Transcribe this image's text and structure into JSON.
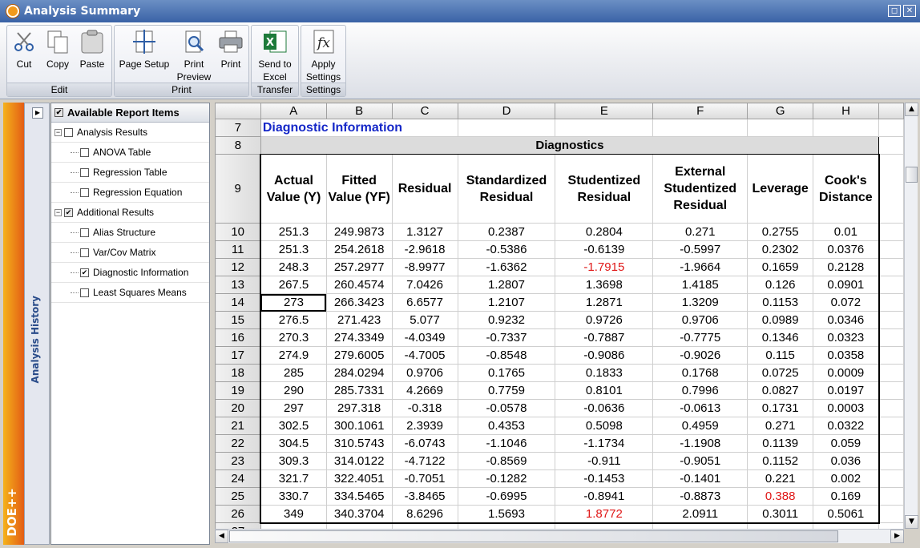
{
  "window": {
    "title": "Analysis Summary"
  },
  "ribbon": {
    "groups": [
      {
        "label": "Edit",
        "buttons": [
          "Cut",
          "Copy",
          "Paste"
        ]
      },
      {
        "label": "Print",
        "buttons": [
          "Page Setup",
          "Print Preview",
          "Print"
        ]
      },
      {
        "label": "Transfer",
        "buttons": [
          "Send to Excel"
        ]
      },
      {
        "label": "Settings",
        "buttons": [
          "Apply Settings"
        ]
      }
    ]
  },
  "brand": "DOE++",
  "history_label": "Analysis History",
  "tree": {
    "header": "Available Report Items",
    "items": [
      {
        "label": "Analysis Results",
        "level": 0,
        "checked": false
      },
      {
        "label": "ANOVA Table",
        "level": 1,
        "checked": false
      },
      {
        "label": "Regression Table",
        "level": 1,
        "checked": false
      },
      {
        "label": "Regression Equation",
        "level": 1,
        "checked": false
      },
      {
        "label": "Additional Results",
        "level": 0,
        "checked": true
      },
      {
        "label": "Alias Structure",
        "level": 1,
        "checked": false
      },
      {
        "label": "Var/Cov Matrix",
        "level": 1,
        "checked": false
      },
      {
        "label": "Diagnostic Information",
        "level": 1,
        "checked": true
      },
      {
        "label": "Least Squares Means",
        "level": 1,
        "checked": false
      }
    ]
  },
  "sheet": {
    "columns": [
      "A",
      "B",
      "C",
      "D",
      "E",
      "F",
      "G",
      "H"
    ],
    "section_title": "Diagnostic Information",
    "table_title": "Diagnostics",
    "headers": [
      "Actual Value (Y)",
      "Fitted Value (YF)",
      "Residual",
      "Standardized Residual",
      "Studentized Residual",
      "External Studentized Residual",
      "Leverage",
      "Cook's Distance"
    ],
    "rows": [
      {
        "n": "10",
        "v": [
          "251.3",
          "249.9873",
          "1.3127",
          "0.2387",
          "0.2804",
          "0.271",
          "0.2755",
          "0.01"
        ]
      },
      {
        "n": "11",
        "v": [
          "251.3",
          "254.2618",
          "-2.9618",
          "-0.5386",
          "-0.6139",
          "-0.5997",
          "0.2302",
          "0.0376"
        ]
      },
      {
        "n": "12",
        "v": [
          "248.3",
          "257.2977",
          "-8.9977",
          "-1.6362",
          "-1.7915",
          "-1.9664",
          "0.1659",
          "0.2128"
        ]
      },
      {
        "n": "13",
        "v": [
          "267.5",
          "260.4574",
          "7.0426",
          "1.2807",
          "1.3698",
          "1.4185",
          "0.126",
          "0.0901"
        ]
      },
      {
        "n": "14",
        "v": [
          "273",
          "266.3423",
          "6.6577",
          "1.2107",
          "1.2871",
          "1.3209",
          "0.1153",
          "0.072"
        ]
      },
      {
        "n": "15",
        "v": [
          "276.5",
          "271.423",
          "5.077",
          "0.9232",
          "0.9726",
          "0.9706",
          "0.0989",
          "0.0346"
        ]
      },
      {
        "n": "16",
        "v": [
          "270.3",
          "274.3349",
          "-4.0349",
          "-0.7337",
          "-0.7887",
          "-0.7775",
          "0.1346",
          "0.0323"
        ]
      },
      {
        "n": "17",
        "v": [
          "274.9",
          "279.6005",
          "-4.7005",
          "-0.8548",
          "-0.9086",
          "-0.9026",
          "0.115",
          "0.0358"
        ]
      },
      {
        "n": "18",
        "v": [
          "285",
          "284.0294",
          "0.9706",
          "0.1765",
          "0.1833",
          "0.1768",
          "0.0725",
          "0.0009"
        ]
      },
      {
        "n": "19",
        "v": [
          "290",
          "285.7331",
          "4.2669",
          "0.7759",
          "0.8101",
          "0.7996",
          "0.0827",
          "0.0197"
        ]
      },
      {
        "n": "20",
        "v": [
          "297",
          "297.318",
          "-0.318",
          "-0.0578",
          "-0.0636",
          "-0.0613",
          "0.1731",
          "0.0003"
        ]
      },
      {
        "n": "21",
        "v": [
          "302.5",
          "300.1061",
          "2.3939",
          "0.4353",
          "0.5098",
          "0.4959",
          "0.271",
          "0.0322"
        ]
      },
      {
        "n": "22",
        "v": [
          "304.5",
          "310.5743",
          "-6.0743",
          "-1.1046",
          "-1.1734",
          "-1.1908",
          "0.1139",
          "0.059"
        ]
      },
      {
        "n": "23",
        "v": [
          "309.3",
          "314.0122",
          "-4.7122",
          "-0.8569",
          "-0.911",
          "-0.9051",
          "0.1152",
          "0.036"
        ]
      },
      {
        "n": "24",
        "v": [
          "321.7",
          "322.4051",
          "-0.7051",
          "-0.1282",
          "-0.1453",
          "-0.1401",
          "0.221",
          "0.002"
        ]
      },
      {
        "n": "25",
        "v": [
          "330.7",
          "334.5465",
          "-3.8465",
          "-0.6995",
          "-0.8941",
          "-0.8873",
          "0.388",
          "0.169"
        ]
      },
      {
        "n": "26",
        "v": [
          "349",
          "340.3704",
          "8.6296",
          "1.5693",
          "1.8772",
          "2.0911",
          "0.3011",
          "0.5061"
        ]
      }
    ],
    "highlight_color": "#e01818",
    "highlights": [
      {
        "row": "12",
        "col": 4
      },
      {
        "row": "25",
        "col": 6
      },
      {
        "row": "26",
        "col": 4
      }
    ],
    "selected_cell": {
      "row": "14",
      "col": 0
    }
  }
}
